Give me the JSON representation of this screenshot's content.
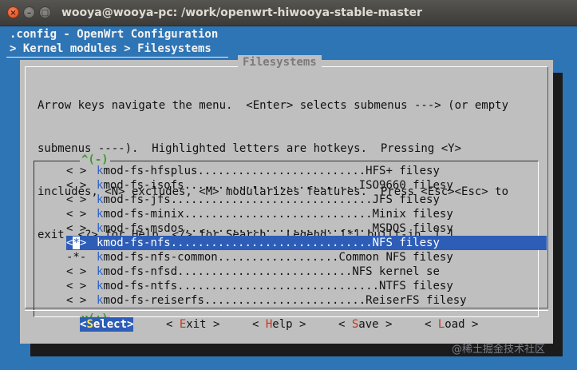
{
  "window": {
    "title": "wooya@wooya-pc: /work/openwrt-hiwooya-stable-master",
    "close_glyph": "×",
    "minimize_glyph": "–",
    "maximize_glyph": "□"
  },
  "header": {
    "line1": ".config - OpenWrt Configuration",
    "line2": "> Kernel modules > Filesystems"
  },
  "dialog": {
    "title": "Filesystems",
    "help_lines": [
      "Arrow keys navigate the menu.  <Enter> selects submenus ---> (or empty",
      "submenus ----).  Highlighted letters are hotkeys.  Pressing <Y>",
      "includes, <N> excludes, <M> modularizes features.  Press <Esc><Esc> to",
      "exit, <?> for Help, </> for Search.  Legend: [*] built-in  [ ]"
    ],
    "scroll_up": "^(-)",
    "scroll_down": "v(+)"
  },
  "menu": {
    "items": [
      {
        "mark": "< >",
        "hotkey": "k",
        "rest": "mod-fs-hfsplus",
        "dots": ".........................",
        "desc": "HFS+ filesy",
        "selected": false
      },
      {
        "mark": "< >",
        "hotkey": "k",
        "rest": "mod-fs-isofs",
        "dots": "..........................",
        "desc": "ISO9660 filesy",
        "selected": false
      },
      {
        "mark": "< >",
        "hotkey": "k",
        "rest": "mod-fs-jfs",
        "dots": "..............................",
        "desc": "JFS filesy",
        "selected": false
      },
      {
        "mark": "< >",
        "hotkey": "k",
        "rest": "mod-fs-minix",
        "dots": "............................",
        "desc": "Minix filesy",
        "selected": false
      },
      {
        "mark": "< >",
        "hotkey": "k",
        "rest": "mod-fs-msdos",
        "dots": "............................",
        "desc": "MSDOS filesy",
        "selected": false
      },
      {
        "mark": "<*>",
        "hotkey": "k",
        "rest": "mod-fs-nfs",
        "dots": "..............................",
        "desc": "NFS filesy",
        "selected": true
      },
      {
        "mark": "-*-",
        "hotkey": "k",
        "rest": "mod-fs-nfs-common",
        "dots": "..................",
        "desc": "Common NFS filesy",
        "selected": false
      },
      {
        "mark": "< >",
        "hotkey": "k",
        "rest": "mod-fs-nfsd",
        "dots": "..........................",
        "desc": "NFS kernel se",
        "selected": false
      },
      {
        "mark": "< >",
        "hotkey": "k",
        "rest": "mod-fs-ntfs",
        "dots": "..............................",
        "desc": "NTFS filesy",
        "selected": false
      },
      {
        "mark": "< >",
        "hotkey": "k",
        "rest": "mod-fs-reiserfs",
        "dots": "........................",
        "desc": "ReiserFS filesy",
        "selected": false
      }
    ]
  },
  "buttons": [
    {
      "pre": "<",
      "hotkey": "S",
      "post": "elect>",
      "active": true
    },
    {
      "pre": "< ",
      "hotkey": "E",
      "post": "xit >",
      "active": false
    },
    {
      "pre": "< ",
      "hotkey": "H",
      "post": "elp >",
      "active": false
    },
    {
      "pre": "< ",
      "hotkey": "S",
      "post": "ave >",
      "active": false
    },
    {
      "pre": "< ",
      "hotkey": "L",
      "post": "oad >",
      "active": false
    }
  ],
  "watermark": "@稀土掘金技术社区",
  "colors": {
    "terminal_bg": "#2e75b6",
    "dialog_bg": "#bfbfbf",
    "selection": "#2e5db8",
    "hotkey": "#2e62c8",
    "button_hotkey": "#c8351f",
    "scroll_indicator": "#3a9b2d"
  }
}
